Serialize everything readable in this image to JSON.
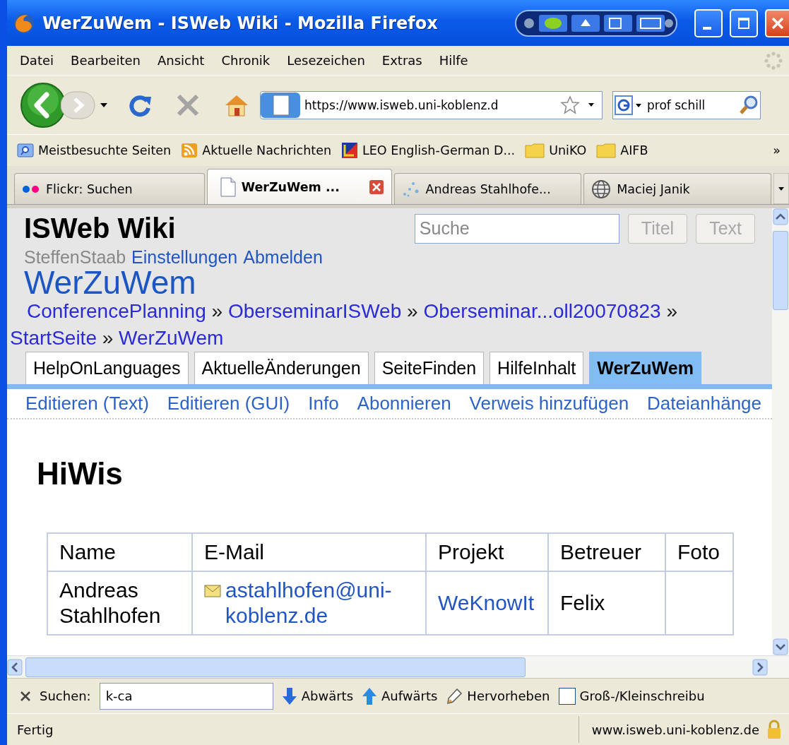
{
  "window": {
    "title": "WerZuWem - ISWeb Wiki - Mozilla Firefox"
  },
  "menu": [
    "Datei",
    "Bearbeiten",
    "Ansicht",
    "Chronik",
    "Lesezeichen",
    "Extras",
    "Hilfe"
  ],
  "navigation": {
    "url": "https://www.isweb.uni-koblenz.d",
    "search_value": "prof schill"
  },
  "bookmarks": [
    {
      "label": "Meistbesuchte Seiten",
      "kind": "smart"
    },
    {
      "label": "Aktuelle Nachrichten",
      "kind": "feed"
    },
    {
      "label": "LEO English-German D...",
      "kind": "site"
    },
    {
      "label": "UniKO",
      "kind": "folder"
    },
    {
      "label": "AIFB",
      "kind": "folder"
    }
  ],
  "bookmarks_overflow": "»",
  "tabs": [
    {
      "label": "Flickr: Suchen",
      "selected": false,
      "kind": "dots"
    },
    {
      "label": "WerZuWem ...",
      "selected": true,
      "kind": "page"
    },
    {
      "label": "Andreas Stahlhofe...",
      "selected": false,
      "kind": "sparkle"
    },
    {
      "label": "Maciej Janik",
      "selected": false,
      "kind": "globe"
    }
  ],
  "wiki": {
    "site_title": "ISWeb Wiki",
    "search_placeholder": "Suche",
    "search_buttons": [
      "Titel",
      "Text"
    ],
    "user": "SteffenStaab",
    "user_links": [
      "Einstellungen",
      "Abmelden"
    ],
    "page_title": "WerZuWem",
    "breadcrumbs": [
      {
        "kind": "link",
        "text": "ConferencePlanning"
      },
      {
        "kind": "separator",
        "text": "»"
      },
      {
        "kind": "link",
        "text": "OberseminarISWeb"
      },
      {
        "kind": "separator",
        "text": "»"
      },
      {
        "kind": "link",
        "text": "Oberseminar...oll20070823"
      },
      {
        "kind": "separator",
        "text": "»"
      },
      {
        "kind": "link",
        "text": "StartSeite"
      },
      {
        "kind": "separator",
        "text": "»"
      },
      {
        "kind": "link",
        "text": "WerZuWem"
      }
    ],
    "nav_tabs": [
      {
        "label": "HelpOnLanguages",
        "selected": false
      },
      {
        "label": "AktuelleÄnderungen",
        "selected": false
      },
      {
        "label": "SeiteFinden",
        "selected": false
      },
      {
        "label": "HilfeInhalt",
        "selected": false
      },
      {
        "label": "WerZuWem",
        "selected": true
      }
    ],
    "actions": [
      "Editieren (Text)",
      "Editieren (GUI)",
      "Info",
      "Abonnieren",
      "Verweis hinzufügen",
      "Dateianhänge"
    ],
    "heading": "HiWis",
    "table": {
      "columns": [
        "Name",
        "E-Mail",
        "Projekt",
        "Betreuer",
        "Foto"
      ],
      "rows": [
        {
          "name": "Andreas Stahlhofen",
          "email": "astahlhofen@uni-koblenz.de",
          "project": "WeKnowIt",
          "supervisor": "Felix"
        }
      ]
    }
  },
  "find_bar": {
    "label": "Suchen:",
    "value": "k-ca",
    "buttons": [
      {
        "label": "Abwärts",
        "kind": "down"
      },
      {
        "label": "Aufwärts",
        "kind": "up"
      },
      {
        "label": "Hervorheben",
        "kind": "highlight"
      }
    ],
    "match_case": {
      "label": "Groß-/Kleinschreibu",
      "checked": false
    }
  },
  "status_bar": {
    "text": "Fertig",
    "host": "www.isweb.uni-koblenz.de"
  }
}
